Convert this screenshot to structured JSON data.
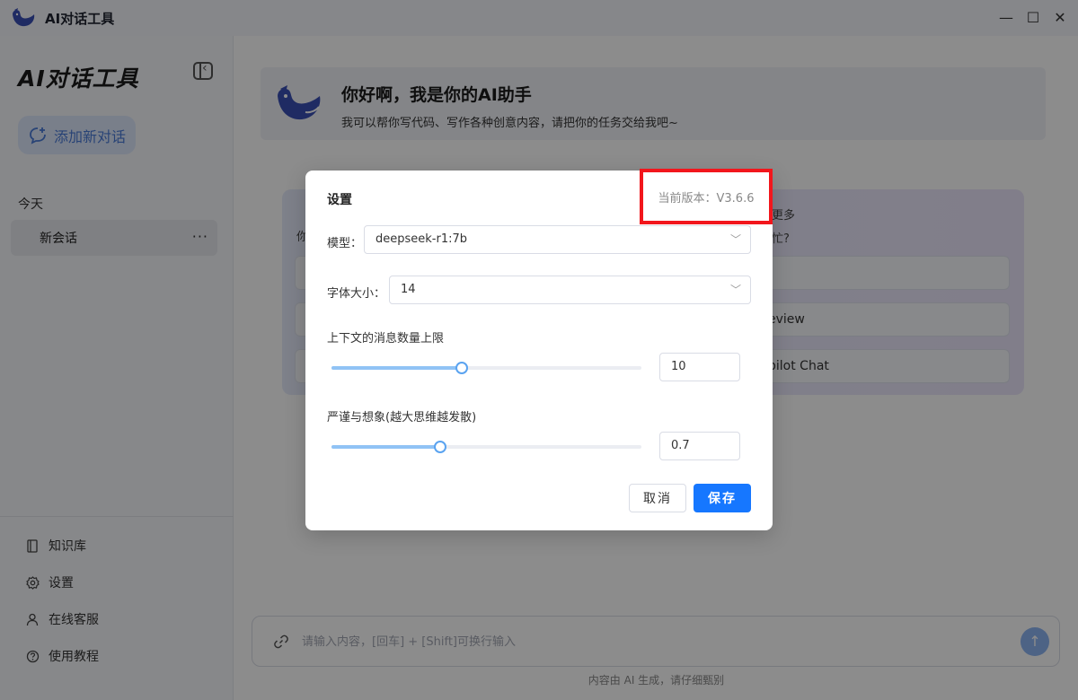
{
  "window": {
    "title": "AI对话工具",
    "minimize": "—",
    "maximize": "☐",
    "close": "✕"
  },
  "sidebar": {
    "brand": "AI对话工具",
    "add_chat_label": "添加新对话",
    "section_today": "今天",
    "conversations": [
      {
        "label": "新会话",
        "more": "···"
      }
    ],
    "links": [
      {
        "label": "知识库",
        "icon": "book-icon"
      },
      {
        "label": "设置",
        "icon": "gear-icon"
      },
      {
        "label": "在线客服",
        "icon": "user-icon"
      },
      {
        "label": "使用教程",
        "icon": "help-icon"
      }
    ]
  },
  "main": {
    "hero_title": "你好啊，我是你的AI助手",
    "hero_subtitle": "我可以帮你写代码、写作各种创意内容，请把你的任务交给我吧~",
    "suggestions": {
      "left_head": "你",
      "right_head_1": "更多",
      "right_head_2": "忙?",
      "right_card_2": "eview",
      "right_card_3": "pilot Chat"
    },
    "input_placeholder": "请输入内容，[回车] + [Shift]可换行输入",
    "send_icon": "↑",
    "footnote": "内容由 AI 生成，请仔细甄别"
  },
  "modal": {
    "title": "设置",
    "version": "当前版本：V3.6.6",
    "model_label": "模型：",
    "model_value": "deepseek-r1:7b",
    "font_label": "字体大小：",
    "font_value": "14",
    "context_label": "上下文的消息数量上限",
    "context_value": "10",
    "context_slider_percent": 42,
    "temp_label": "严谨与想象(越大思维越发散)",
    "temp_value": "0.7",
    "temp_slider_percent": 35,
    "cancel_label": "取消",
    "save_label": "保存"
  },
  "colors": {
    "accent": "#1677ff",
    "highlight_box": "#f2161c"
  }
}
